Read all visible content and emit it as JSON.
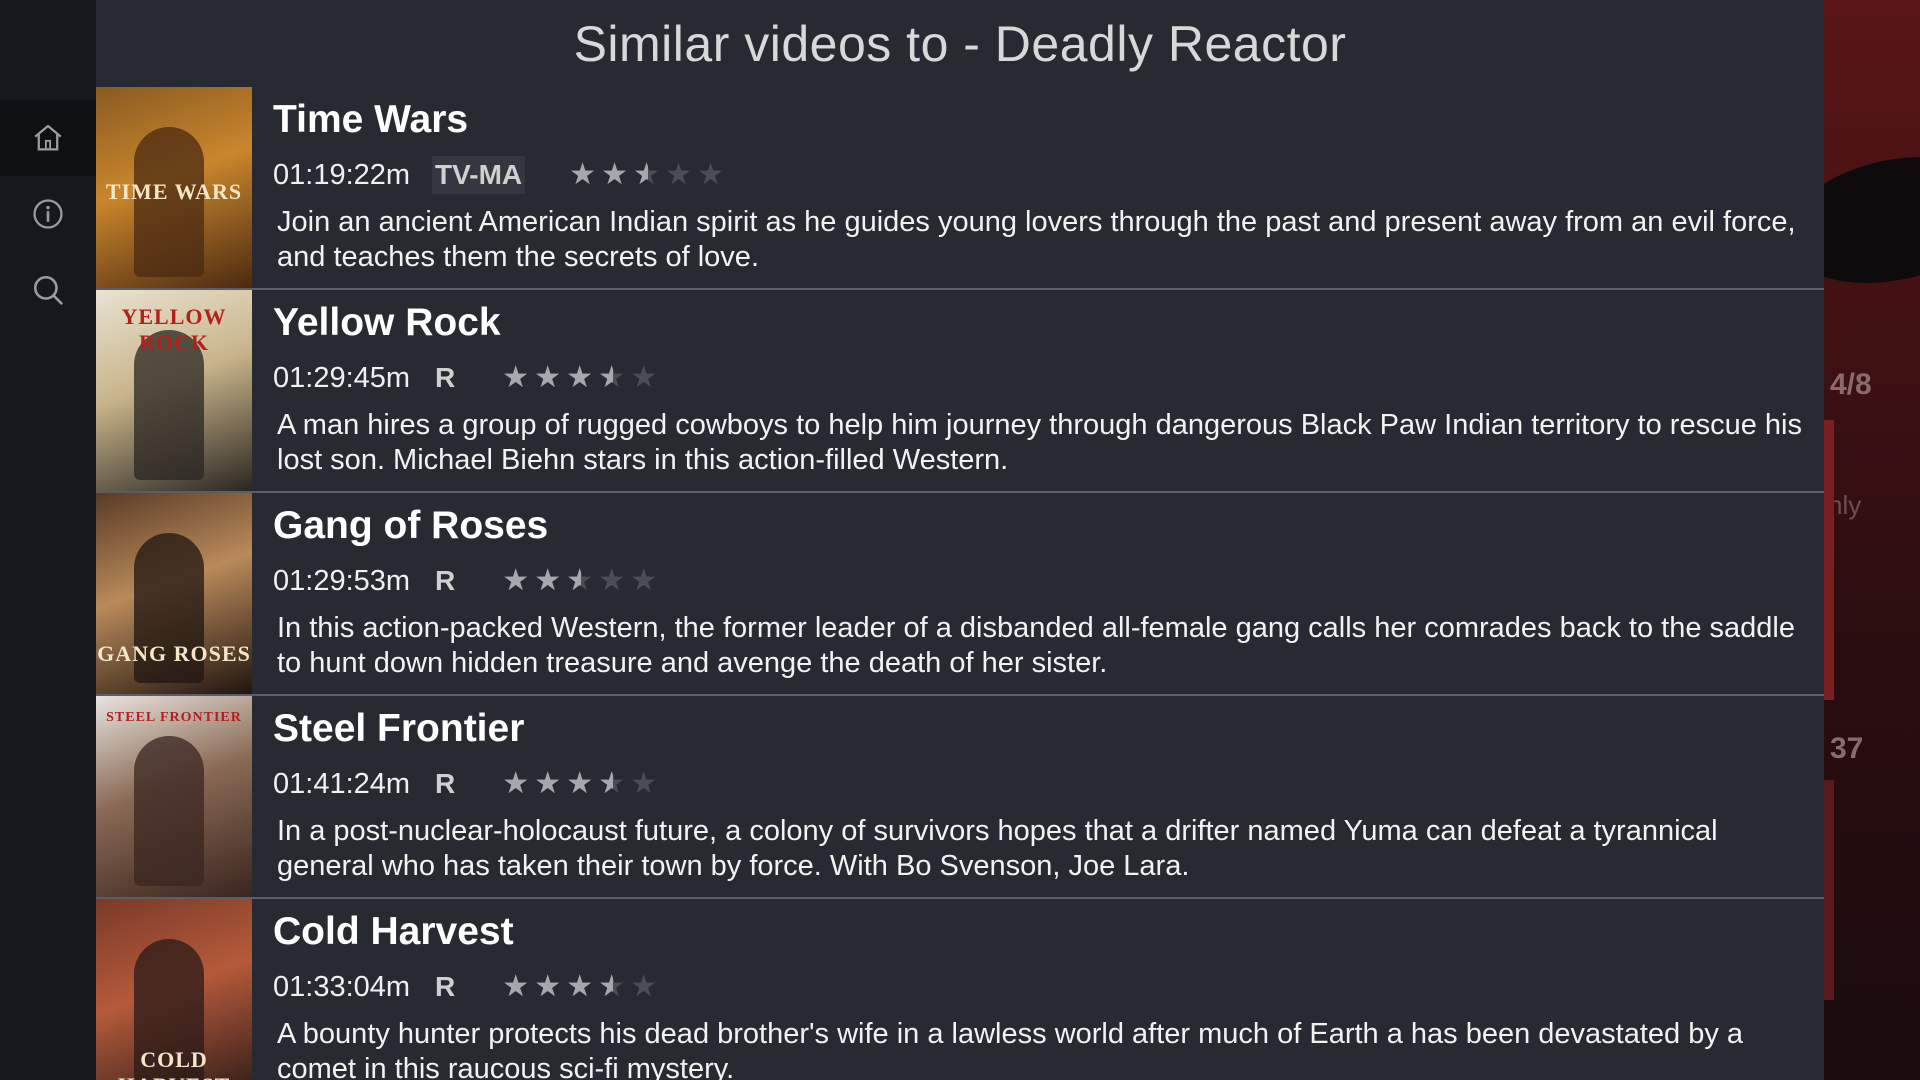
{
  "header": {
    "title": "Similar videos to - Deadly Reactor"
  },
  "nav": {
    "items": [
      {
        "name": "home",
        "icon": "home-icon"
      },
      {
        "name": "info",
        "icon": "info-icon"
      },
      {
        "name": "search",
        "icon": "search-icon"
      }
    ]
  },
  "background": {
    "counter_1": "4/8",
    "counter_2": "37",
    "partial_text": "nly"
  },
  "videos": [
    {
      "title": "Time Wars",
      "duration": "01:19:22m",
      "rating": "TV-MA",
      "stars": 2.5,
      "poster_text": "TIME WARS",
      "poster_colors": [
        "#8a5a22",
        "#c9862c",
        "#4b2a12"
      ],
      "description": "Join an ancient American Indian spirit as he guides young lovers through the past and present away from an evil force, and teaches them the secrets of love."
    },
    {
      "title": "Yellow Rock",
      "duration": "01:29:45m",
      "rating": "R",
      "stars": 3.5,
      "poster_text": "YELLOW ROCK",
      "poster_colors": [
        "#e9e3d2",
        "#c8b48a",
        "#2a2622"
      ],
      "description": "A man hires a group of rugged cowboys to help him journey through dangerous Black Paw Indian territory to rescue his lost son. Michael Biehn stars in this action-filled Western."
    },
    {
      "title": "Gang of Roses",
      "duration": "01:29:53m",
      "rating": "R",
      "stars": 2.5,
      "poster_text": "GANG ROSES",
      "poster_colors": [
        "#5a3a26",
        "#b98a5a",
        "#1f1510"
      ],
      "description": "In this action-packed Western, the former leader of a disbanded all-female gang calls her comrades back to the saddle to hunt down hidden treasure and avenge the death of her sister."
    },
    {
      "title": "Steel Frontier",
      "duration": "01:41:24m",
      "rating": "R",
      "stars": 3.5,
      "poster_text": "STEEL FRONTIER",
      "poster_colors": [
        "#e8e4df",
        "#8a6a55",
        "#3a2520"
      ],
      "description": "In a post-nuclear-holocaust future, a colony of survivors hopes that a drifter named Yuma can defeat a tyrannical general who has taken their town by force. With Bo Svenson, Joe Lara."
    },
    {
      "title": "Cold Harvest",
      "duration": "01:33:04m",
      "rating": "R",
      "stars": 3.5,
      "poster_text": "COLD HARVEST",
      "poster_colors": [
        "#7a3a28",
        "#b55a3a",
        "#2a1a18"
      ],
      "description": "A bounty hunter protects his dead brother's wife in a lawless world after much of Earth a has been devastated by a comet in this raucous sci-fi mystery."
    }
  ]
}
